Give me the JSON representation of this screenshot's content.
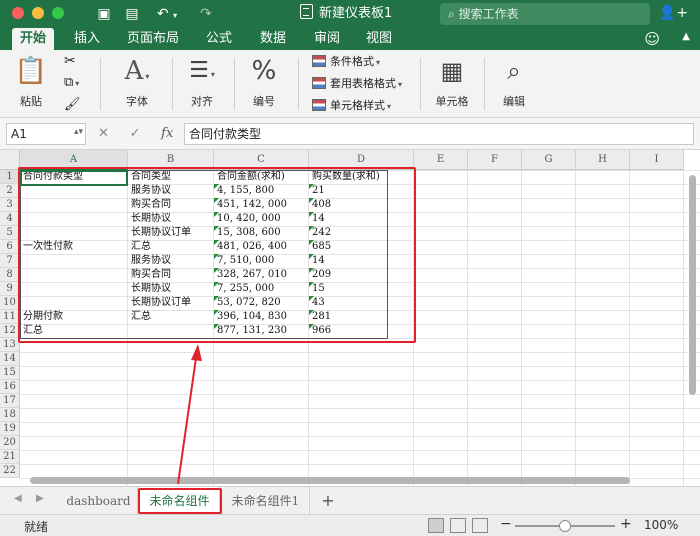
{
  "window": {
    "title": "新建仪表板1",
    "search_placeholder": "搜索工作表"
  },
  "ribbon_tabs": [
    "开始",
    "插入",
    "页面布局",
    "公式",
    "数据",
    "审阅",
    "视图"
  ],
  "ribbon": {
    "paste": "粘贴",
    "font": "字体",
    "align": "对齐",
    "number": "编号",
    "conditional_format": "条件格式",
    "table_format": "套用表格格式",
    "cell_style": "单元格样式",
    "cells": "单元格",
    "edit": "编辑",
    "font_icon": "A",
    "number_icon": "%"
  },
  "formula_bar": {
    "name_box": "A1",
    "fx": "fx",
    "formula": "合同付款类型"
  },
  "columns": [
    "A",
    "B",
    "C",
    "D",
    "E",
    "F",
    "G",
    "H",
    "I"
  ],
  "rows": [
    "1",
    "2",
    "3",
    "4",
    "5",
    "6",
    "7",
    "8",
    "9",
    "10",
    "11",
    "12",
    "13",
    "14",
    "15",
    "16",
    "17",
    "18",
    "19",
    "20",
    "21",
    "22"
  ],
  "pivot": {
    "headers": [
      "合同付款类型",
      "合同类型",
      "合同金额(求和)",
      "购买数量(求和)"
    ],
    "rows": [
      [
        "",
        "服务协议",
        "4, 155, 800",
        "21"
      ],
      [
        "",
        "购买合同",
        "451, 142, 000",
        "408"
      ],
      [
        "",
        "长期协议",
        "10, 420, 000",
        "14"
      ],
      [
        "",
        "长期协议订单",
        "15, 308, 600",
        "242"
      ],
      [
        "一次性付款",
        "汇总",
        "481, 026, 400",
        "685"
      ],
      [
        "",
        "服务协议",
        "7, 510, 000",
        "14"
      ],
      [
        "",
        "购买合同",
        "328, 267, 010",
        "209"
      ],
      [
        "",
        "长期协议",
        "7, 255, 000",
        "15"
      ],
      [
        "",
        "长期协议订单",
        "53, 072, 820",
        "43"
      ],
      [
        "分期付款",
        "汇总",
        "396, 104, 830",
        "281"
      ],
      [
        "汇总",
        "",
        "877, 131, 230",
        "966"
      ]
    ]
  },
  "sheets": [
    "dashboard",
    "未命名组件",
    "未命名组件1"
  ],
  "status": {
    "ready": "就绪",
    "zoom": "100%",
    "zoom_fraction": 0.5
  },
  "colors": {
    "brand": "#217346",
    "highlight": "#e1222b"
  }
}
